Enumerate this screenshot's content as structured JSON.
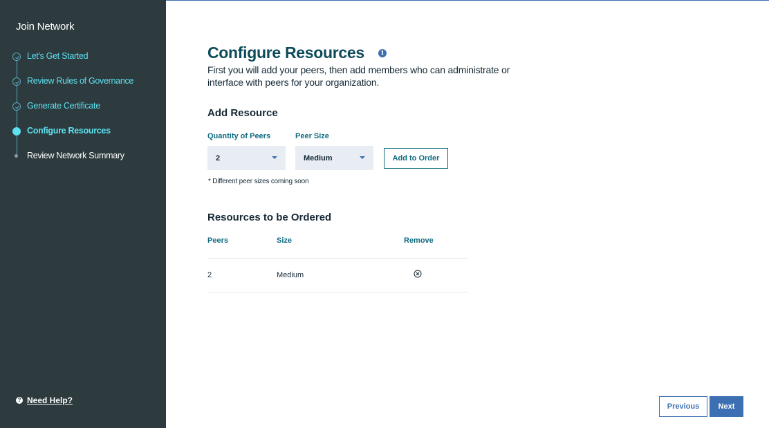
{
  "sidebar": {
    "title": "Join Network",
    "steps": [
      {
        "label": "Let's Get Started",
        "status": "complete"
      },
      {
        "label": "Review Rules of Governance",
        "status": "complete"
      },
      {
        "label": "Generate Certificate",
        "status": "complete"
      },
      {
        "label": "Configure Resources",
        "status": "active"
      },
      {
        "label": "Review Network Summary",
        "status": "pending"
      }
    ],
    "help_label": "Need Help?",
    "help_icon": "question-icon"
  },
  "main": {
    "title": "Configure Resources",
    "title_icon": "info-icon",
    "description": "First you will add your peers, then add members who can administrate or interface with peers for your organization.",
    "add_resource": {
      "heading": "Add Resource",
      "quantity_label": "Quantity of Peers",
      "quantity_value": "2",
      "size_label": "Peer Size",
      "size_value": "Medium",
      "add_button": "Add to Order",
      "note": "* Different peer sizes coming soon"
    },
    "order": {
      "heading": "Resources to be Ordered",
      "columns": [
        "Peers",
        "Size",
        "Remove"
      ],
      "rows": [
        {
          "peers": "2",
          "size": "Medium",
          "remove_icon": "close-circle-icon"
        }
      ]
    }
  },
  "footer": {
    "previous_label": "Previous",
    "next_label": "Next"
  },
  "colors": {
    "sidebar_bg": "#2d3a3e",
    "accent_cyan": "#5ee0ef",
    "title_teal": "#0e4b5a",
    "label_teal": "#0e6b80",
    "primary_blue": "#3d70b2",
    "select_bg": "#e8edf3"
  }
}
